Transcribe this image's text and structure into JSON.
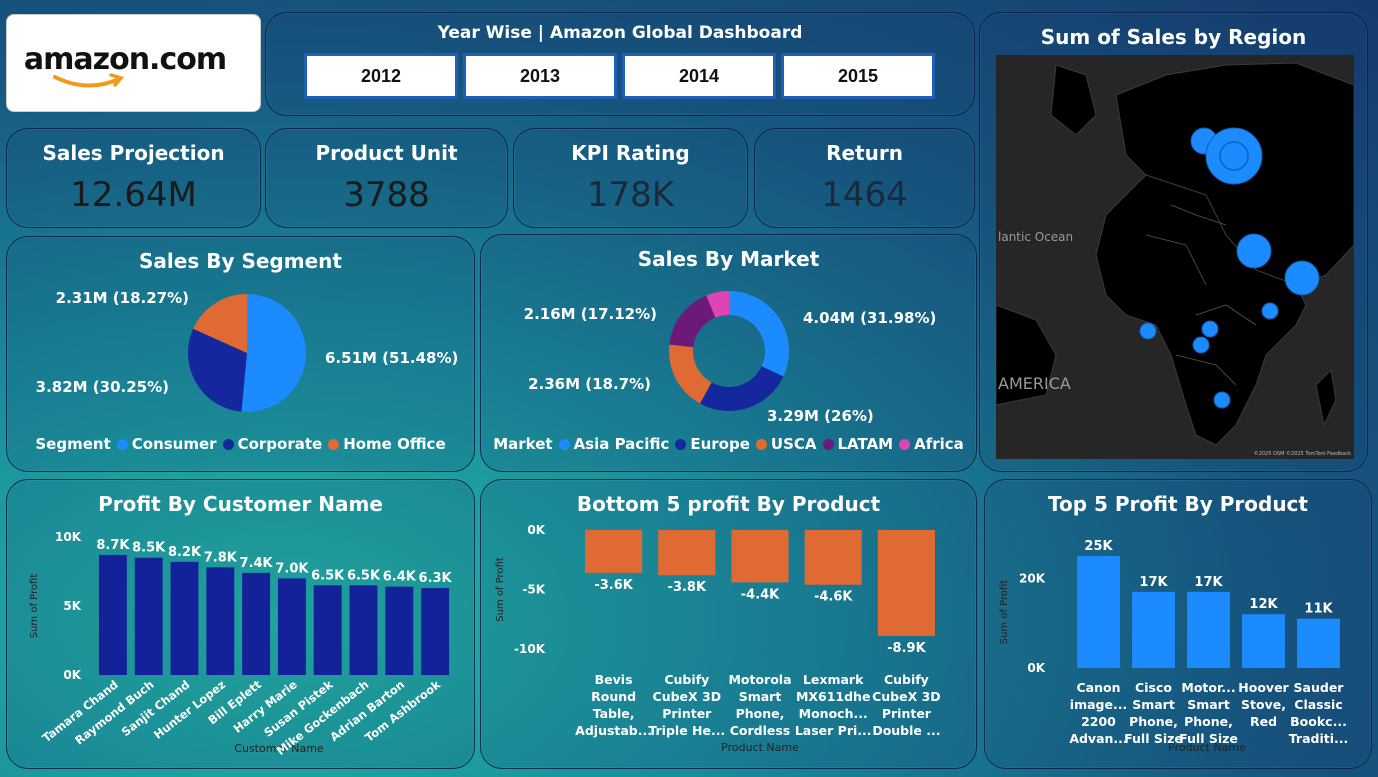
{
  "logo": {
    "text": "amazon.com"
  },
  "header": {
    "title": "Year Wise | Amazon Global Dashboard",
    "years": [
      "2012",
      "2013",
      "2014",
      "2015"
    ]
  },
  "kpis": [
    {
      "label": "Sales Projection",
      "value": "12.64M",
      "color": "#1a1a1a"
    },
    {
      "label": "Product Unit",
      "value": "3788",
      "color": "#1a1a1a"
    },
    {
      "label": "KPI Rating",
      "value": "178K",
      "color": "#1a2a3a"
    },
    {
      "label": "Return",
      "value": "1464",
      "color": "#1a2a3a"
    }
  ],
  "map": {
    "title": "Sum of Sales by Region",
    "ocean_label": "lantic Ocean",
    "continent_label": "AMERICA",
    "attribution": "©2025 OSM ©2025 TomTom Feedback"
  },
  "chart_data": [
    {
      "id": "segment",
      "type": "pie",
      "title": "Sales By Segment",
      "legend_title": "Segment",
      "labels": [
        "Consumer",
        "Corporate",
        "Home Office"
      ],
      "values": [
        6.51,
        3.82,
        2.31
      ],
      "data_labels": [
        "6.51M (51.48%)",
        "3.82M (30.25%)",
        "2.31M (18.27%)"
      ],
      "colors": [
        "#1c8bff",
        "#14279c",
        "#e06a33"
      ]
    },
    {
      "id": "market",
      "type": "pie",
      "title": "Sales By Market",
      "legend_title": "Market",
      "labels": [
        "Asia Pacific",
        "Europe",
        "USCA",
        "LATAM",
        "Africa"
      ],
      "values": [
        4.04,
        3.29,
        2.36,
        2.16,
        0.78
      ],
      "data_labels": [
        "4.04M (31.98%)",
        "3.29M (26%)",
        "2.36M (18.7%)",
        "2.16M (17.12%)",
        ""
      ],
      "colors": [
        "#1c8bff",
        "#14279c",
        "#e06a33",
        "#6b1a7a",
        "#e043b4"
      ]
    },
    {
      "id": "customer",
      "type": "bar",
      "title": "Profit By Customer Name",
      "xlabel": "Customer Name",
      "ylabel": "Sum of Profit",
      "ylim": [
        0,
        10000
      ],
      "yticks": [
        "0K",
        "5K",
        "10K"
      ],
      "categories": [
        "Tamara Chand",
        "Raymond Buch",
        "Sanjit Chand",
        "Hunter Lopez",
        "Bill Eplett",
        "Harry Marie",
        "Susan Pistek",
        "Mike Gockenbach",
        "Adrian Barton",
        "Tom Ashbrook"
      ],
      "values": [
        8700,
        8500,
        8200,
        7800,
        7400,
        7000,
        6500,
        6500,
        6400,
        6300
      ],
      "data_labels": [
        "8.7K",
        "8.5K",
        "8.2K",
        "7.8K",
        "7.4K",
        "7.0K",
        "6.5K",
        "6.5K",
        "6.4K",
        "6.3K"
      ],
      "color": "#14229a"
    },
    {
      "id": "bottom5",
      "type": "bar",
      "title": "Bottom 5 profit By Product",
      "xlabel": "Product Name",
      "ylabel": "Sum of Profit",
      "ylim": [
        -10000,
        0
      ],
      "yticks": [
        "0K",
        "-5K",
        "-10K"
      ],
      "categories": [
        [
          "Bevis",
          "Round",
          "Table,",
          "Adjustab..."
        ],
        [
          "Cubify",
          "CubeX 3D",
          "Printer",
          "Triple He..."
        ],
        [
          "Motorola",
          "Smart",
          "Phone,",
          "Cordless"
        ],
        [
          "Lexmark",
          "MX611dhe",
          "Monoch...",
          "Laser Pri..."
        ],
        [
          "Cubify",
          "CubeX 3D",
          "Printer",
          "Double ..."
        ]
      ],
      "values": [
        -3600,
        -3800,
        -4400,
        -4600,
        -8900
      ],
      "data_labels": [
        "-3.6K",
        "-3.8K",
        "-4.4K",
        "-4.6K",
        "-8.9K"
      ],
      "color": "#e06a33"
    },
    {
      "id": "top5",
      "type": "bar",
      "title": "Top 5 Profit By Product",
      "xlabel": "Product Name",
      "ylabel": "Sum of Profit",
      "ylim": [
        0,
        25000
      ],
      "yticks": [
        "0K",
        "20K"
      ],
      "categories": [
        [
          "Canon",
          "image...",
          "2200",
          "Advan..."
        ],
        [
          "Cisco",
          "Smart",
          "Phone,",
          "Full Size"
        ],
        [
          "Motor...",
          "Smart",
          "Phone,",
          "Full Size"
        ],
        [
          "Hoover",
          "Stove,",
          "Red"
        ],
        [
          "Sauder",
          "Classic",
          "Bookc...",
          "Traditi..."
        ]
      ],
      "values": [
        25000,
        17000,
        17000,
        12000,
        11000
      ],
      "data_labels": [
        "25K",
        "17K",
        "17K",
        "12K",
        "11K"
      ],
      "color": "#1c8bff"
    }
  ]
}
